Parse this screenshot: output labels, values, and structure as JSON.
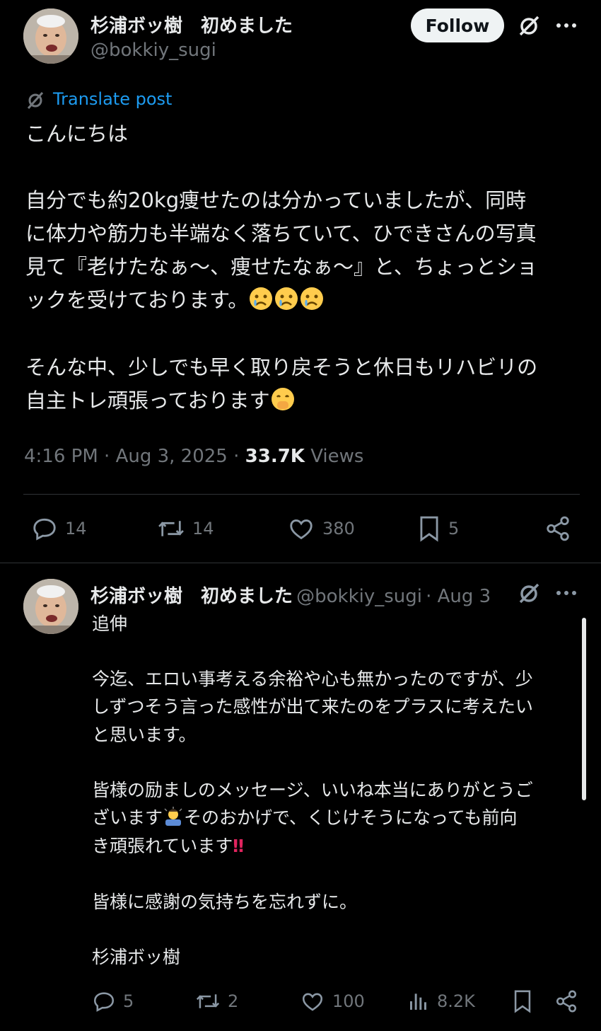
{
  "tweet": {
    "author_name": "杉浦ボッ樹　初めました",
    "author_handle": "@bokkiy_sugi",
    "follow_label": "Follow",
    "translate_label": "Translate post",
    "line1": "こんにちは",
    "para2": "自分でも約20kg痩せたのは分かっていましたが、同時\nに体力や筋力も半端なく落ちていて、ひできさんの写真\n見て『老けたなぁ〜、痩せたなぁ〜』と、ちょっとショ\nックを受けております。",
    "para3": "そんな中、少しでも早く取り戻そうと休日もリハビリの\n自主トレ頑張っております",
    "time": "4:16 PM",
    "date": "Aug 3, 2025",
    "views_count": "33.7K",
    "views_label": "Views",
    "replies": "14",
    "reposts": "14",
    "likes": "380",
    "bookmarks": "5"
  },
  "reply": {
    "author_name": "杉浦ボッ樹　初めました",
    "author_handle": "@bokkiy_sugi",
    "date": "Aug 3",
    "line1": "追伸",
    "para2": "今迄、エロい事考える余裕や心も無かったのですが、少\nしずつそう言った感性が出て来たのをプラスに考えたい\nと思います。",
    "para3a": "皆様の励ましのメッセージ、いいね本当にありがとうご\nざいます",
    "para3b": "そのおかげで、くじけそうになっても前向\nき頑張れています",
    "para4": "皆様に感謝の気持ちを忘れずに。",
    "signature": "杉浦ボッ樹",
    "replies": "5",
    "reposts": "2",
    "likes": "100",
    "views": "8.2K"
  },
  "icons": [
    "grok-icon",
    "more-icon",
    "translate-icon",
    "reply-icon",
    "repost-icon",
    "like-icon",
    "bookmark-icon",
    "share-icon",
    "views-icon",
    "crying-face-emoji",
    "hand-over-mouth-emoji",
    "bowing-person-emoji",
    "double-exclamation-emoji"
  ],
  "colors": {
    "background": "#000000",
    "text": "#e7e9ea",
    "muted": "#71767b",
    "link": "#1d9bf0",
    "divider": "#2f3336"
  }
}
